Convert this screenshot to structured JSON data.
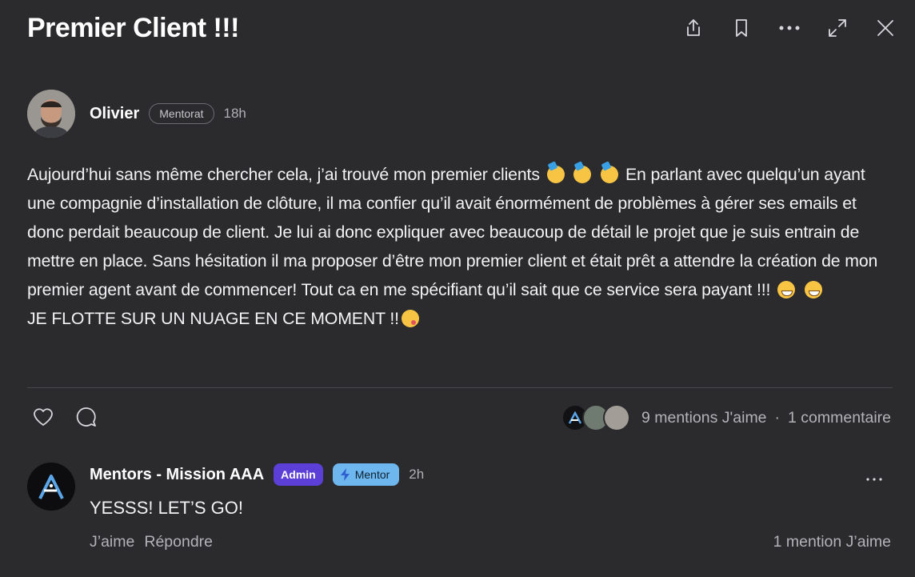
{
  "post": {
    "title": "Premier Client !!!",
    "author": "Olivier",
    "author_tag": "Mentorat",
    "time": "18h",
    "body_lines": [
      "Aujourd’hui sans même chercher cela, j’ai trouvé mon premier clients",
      "En parlant avec quelqu’un ayant une compagnie d’installation de clôture, il ma confier qu’il avait énormément de problèmes à gérer ses emails et donc perdait beaucoup de client. Je lui ai donc expliquer avec beaucoup de détail le projet que je suis entrain de mettre en place. Sans hésitation il ma proposer d’être mon premier client et était prêt a attendre la création de mon premier agent avant de commencer! Tout ca en me spécifiant qu’il sait que ce service sera payant !!!",
      "JE FLOTTE SUR UN NUAGE EN CE  MOMENT !!"
    ],
    "likes": "9 mentions J'aime",
    "comments": "1 commentaire",
    "separator": "·"
  },
  "comment": {
    "author": "Mentors - Mission AAA",
    "admin_badge": "Admin",
    "mentor_badge": "Mentor",
    "time": "2h",
    "text": "YESSS! LET’S GO!",
    "like_action": "J’aime",
    "reply_action": "Répondre",
    "likes": "1 mention J’aime"
  },
  "icons": {
    "share": "share-icon",
    "bookmark": "bookmark-icon",
    "more": "more-icon",
    "expand": "expand-icon",
    "close": "close-icon",
    "heart": "heart-icon",
    "comment": "comment-icon",
    "bolt": "bolt-icon"
  },
  "colors": {
    "background": "#2b2b2e",
    "admin_badge": "#5b3fd6",
    "mentor_badge": "#6eb6ee"
  }
}
